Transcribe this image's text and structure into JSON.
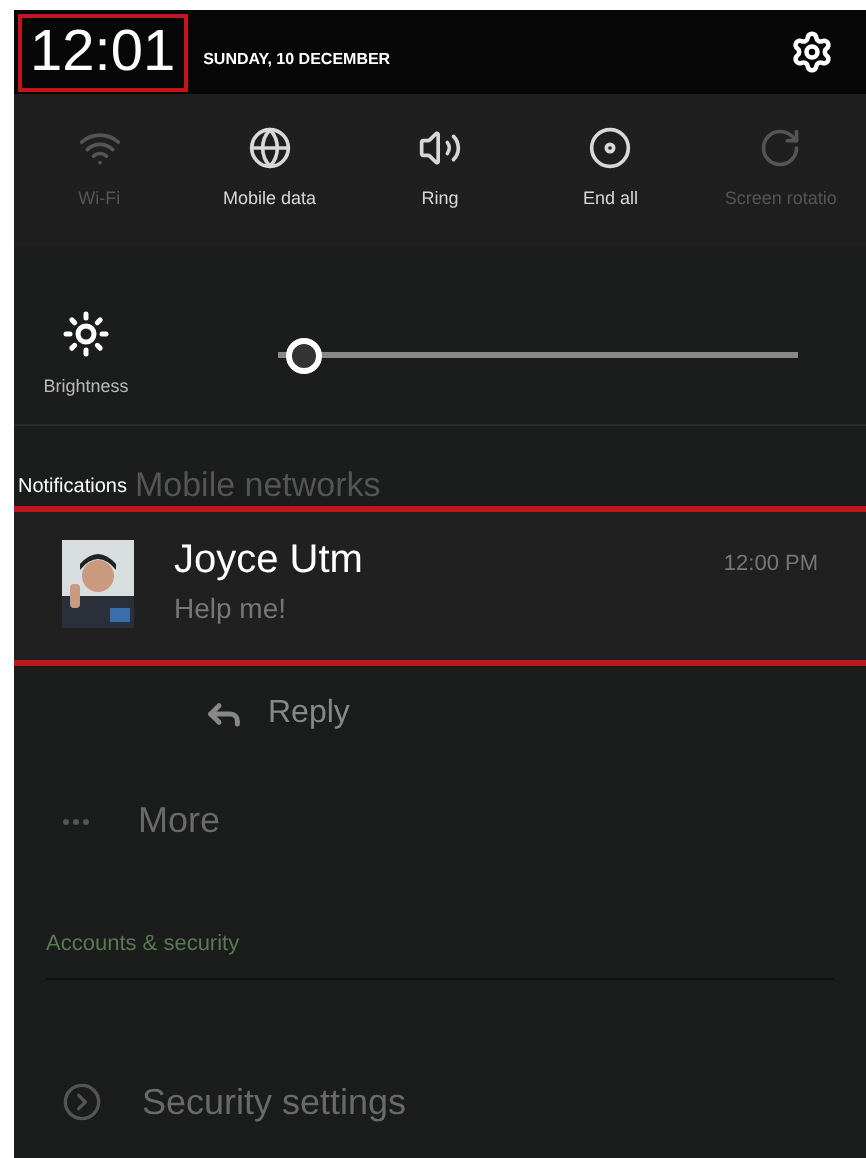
{
  "header": {
    "time": "12:01",
    "time_highlighted": true,
    "date": "SUNDAY, 10 DECEMBER"
  },
  "toggles": [
    {
      "kind": "wifi",
      "label": "Wi-Fi",
      "on": false
    },
    {
      "kind": "data",
      "label": "Mobile data",
      "on": true
    },
    {
      "kind": "sound",
      "label": "Ring",
      "on": true
    },
    {
      "kind": "endall",
      "label": "End all",
      "on": true
    },
    {
      "kind": "rotation",
      "label": "Screen rotatio",
      "on": false
    }
  ],
  "brightness": {
    "label": "Brightness",
    "level": 0.03
  },
  "notifications": {
    "label": "Notifications",
    "behind_text": "Mobile networks",
    "items": [
      {
        "sender": "Joyce Utm",
        "message": "Help me!",
        "time": "12:00 PM",
        "highlighted": true,
        "action": "Reply"
      }
    ]
  },
  "settings": {
    "more": "More",
    "section": "Accounts & security",
    "item": "Security settings"
  }
}
